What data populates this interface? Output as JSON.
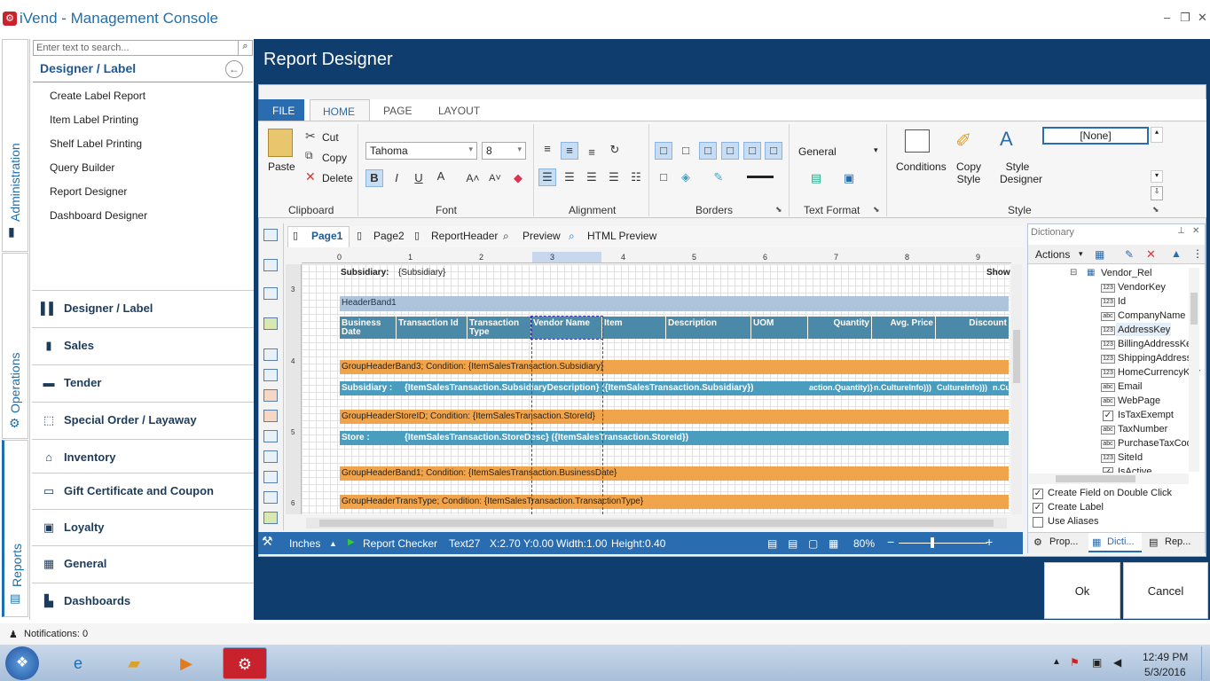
{
  "app": {
    "title": "iVend - Management Console",
    "logo_color": "#c8232c"
  },
  "window": {
    "minimize": "–",
    "restore": "❐",
    "close": "✕"
  },
  "rail": {
    "administration": "Administration",
    "operations": "Operations",
    "reports": "Reports"
  },
  "search": {
    "placeholder": "Enter text to search..."
  },
  "nav": {
    "header": "Designer / Label",
    "subitems": [
      "Create Label Report",
      "Item Label Printing",
      "Shelf Label Printing",
      "Query Builder",
      "Report Designer",
      "Dashboard Designer"
    ],
    "categories": [
      "Designer / Label",
      "Sales",
      "Tender",
      "Special Order / Layaway",
      "Inventory",
      "Gift Certificate and Coupon",
      "Loyalty",
      "General",
      "Dashboards"
    ]
  },
  "page": {
    "title": "Report Designer"
  },
  "ribbon": {
    "tabs": [
      "FILE",
      "HOME",
      "PAGE",
      "LAYOUT"
    ],
    "active_tab": "HOME",
    "clipboard": {
      "paste": "Paste",
      "cut": "Cut",
      "copy": "Copy",
      "delete": "Delete",
      "label": "Clipboard"
    },
    "font": {
      "family": "Tahoma",
      "size": "8",
      "label": "Font",
      "bold": "B",
      "italic": "I",
      "underline": "U"
    },
    "alignment": {
      "label": "Alignment"
    },
    "borders": {
      "label": "Borders"
    },
    "text_format": {
      "value": "General",
      "label": "Text Format"
    },
    "conditions": "Conditions",
    "copy_style": "Copy Style",
    "style_designer": "Style Designer",
    "style": {
      "value": "[None]",
      "label": "Style"
    }
  },
  "doc_tabs": [
    "Page1",
    "Page2",
    "ReportHeader",
    "Preview",
    "HTML Preview"
  ],
  "ruler": [
    "0",
    "1",
    "2",
    "3",
    "4",
    "5",
    "6",
    "7",
    "8",
    "9"
  ],
  "vruler": [
    "3",
    "4",
    "5",
    "6"
  ],
  "report": {
    "subsidiary_label": "Subsidiary:",
    "subsidiary_value": "{Subsidiary}",
    "show_label": "Show",
    "header_band": "HeaderBand1",
    "columns": [
      "Business Date",
      "Transaction Id",
      "Transaction Type",
      "Vendor Name",
      "Item",
      "Description",
      "UOM",
      "Quantity",
      "Avg. Price",
      "Discount"
    ],
    "bands": [
      "GroupHeaderBand3; Condition: {ItemSalesTransaction.Subsidiary}",
      "Subsidiary :",
      "{ItemSalesTransaction.SubsidiaryDescription} ({ItemSalesTransaction.Subsidiary})",
      "action.Quantity)}",
      "n.CultureInfo)))",
      "CultureInfo)))",
      "n.Cu",
      "GroupHeaderStoreID; Condition: {ItemSalesTransaction.StoreId}",
      "Store :",
      "{ItemSalesTransaction.StoreDesc} ({ItemSalesTransaction.StoreId})",
      "GroupHeaderBand1; Condition: {ItemSalesTransaction.BusinessDate}",
      "GroupHeaderTransType; Condition: {ItemSalesTransaction.TransactionType}"
    ]
  },
  "status": {
    "units": "Inches",
    "checker": "Report Checker",
    "component": "Text27",
    "x": "X:2.70",
    "y": "Y:0.00",
    "width": "Width:1.00",
    "height": "Height:0.40",
    "zoom": "80%"
  },
  "dictionary": {
    "title": "Dictionary",
    "actions": "Actions",
    "root": "Vendor_Rel",
    "fields": [
      {
        "name": "VendorKey",
        "type": "123"
      },
      {
        "name": "Id",
        "type": "123"
      },
      {
        "name": "CompanyName",
        "type": "abc"
      },
      {
        "name": "AddressKey",
        "type": "123"
      },
      {
        "name": "BillingAddressKey",
        "type": "123"
      },
      {
        "name": "ShippingAddress",
        "type": "123"
      },
      {
        "name": "HomeCurrencyKey",
        "type": "123"
      },
      {
        "name": "Email",
        "type": "abc"
      },
      {
        "name": "WebPage",
        "type": "abc"
      },
      {
        "name": "IsTaxExempt",
        "type": "check"
      },
      {
        "name": "TaxNumber",
        "type": "abc"
      },
      {
        "name": "PurchaseTaxCod",
        "type": "abc"
      },
      {
        "name": "SiteId",
        "type": "123"
      },
      {
        "name": "IsActive",
        "type": "check"
      }
    ],
    "options": [
      {
        "label": "Create Field on Double Click",
        "checked": "✓"
      },
      {
        "label": "Create Label",
        "checked": "✓"
      },
      {
        "label": "Use Aliases",
        "checked": ""
      }
    ],
    "tabs": [
      "Prop...",
      "Dicti...",
      "Rep..."
    ]
  },
  "buttons": {
    "ok": "Ok",
    "cancel": "Cancel"
  },
  "notifications": "Notifications: 0",
  "clock": {
    "time": "12:49 PM",
    "date": "5/3/2016"
  }
}
